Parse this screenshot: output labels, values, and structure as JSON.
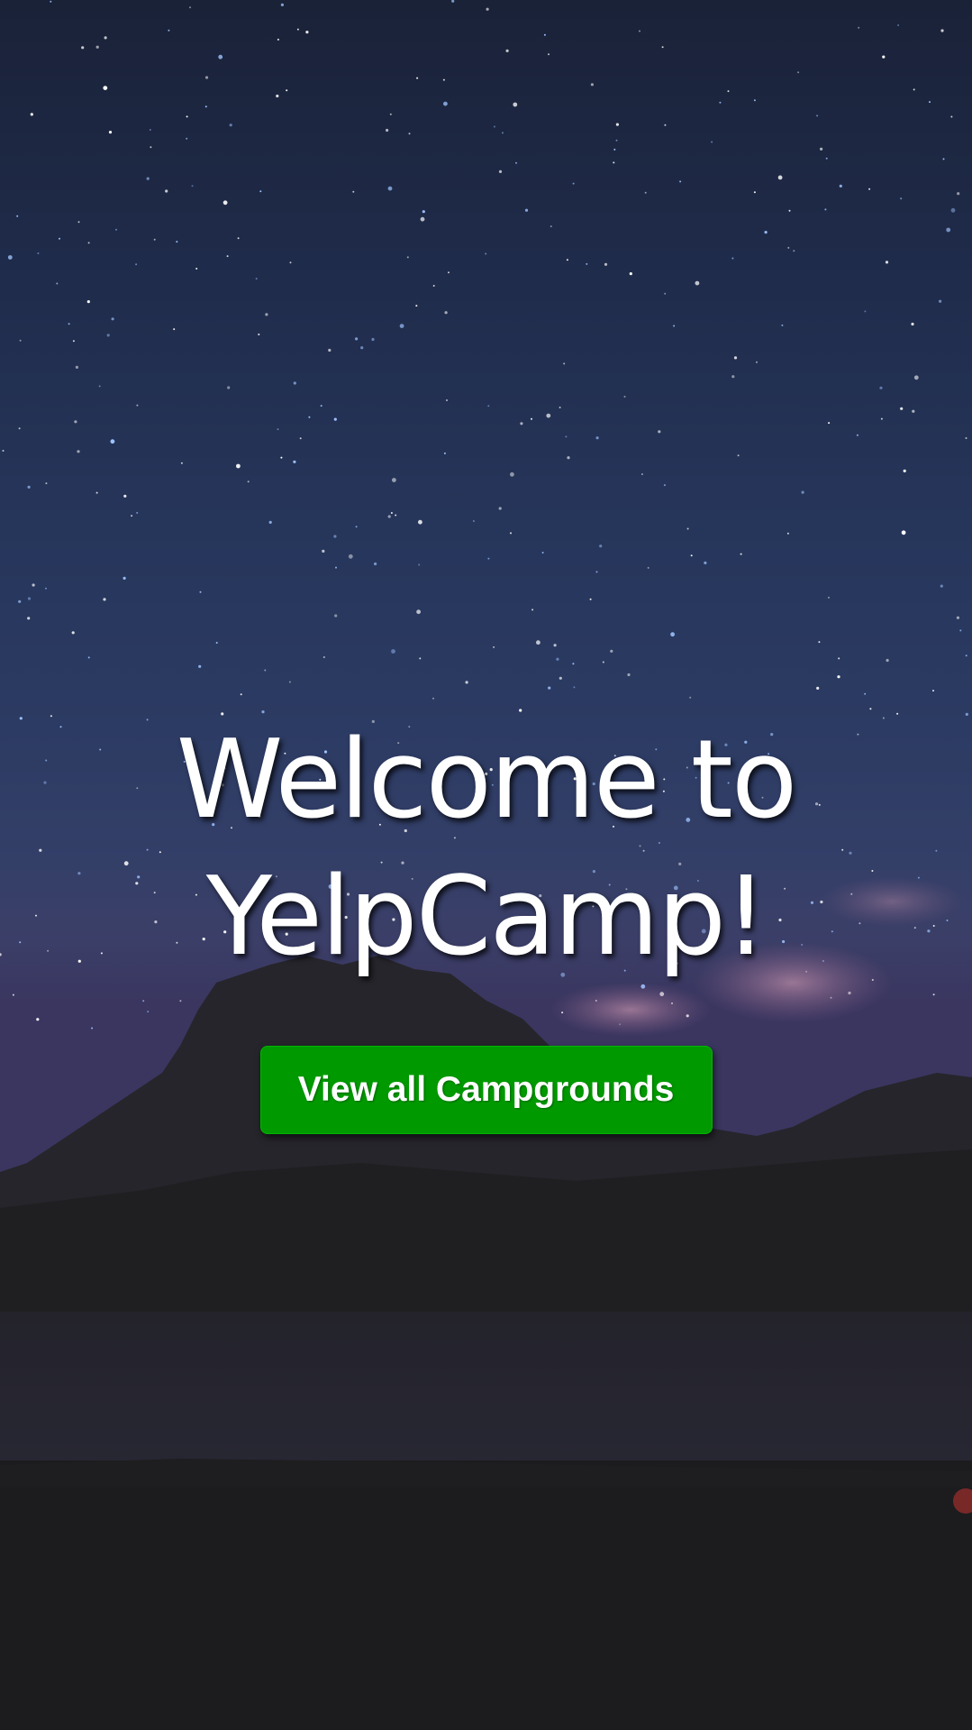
{
  "hero": {
    "title_line1": "Welcome to",
    "title_line2": "YelpCamp!",
    "cta_label": "View all Campgrounds"
  },
  "colors": {
    "cta_background": "#009a00",
    "text": "#ffffff"
  }
}
